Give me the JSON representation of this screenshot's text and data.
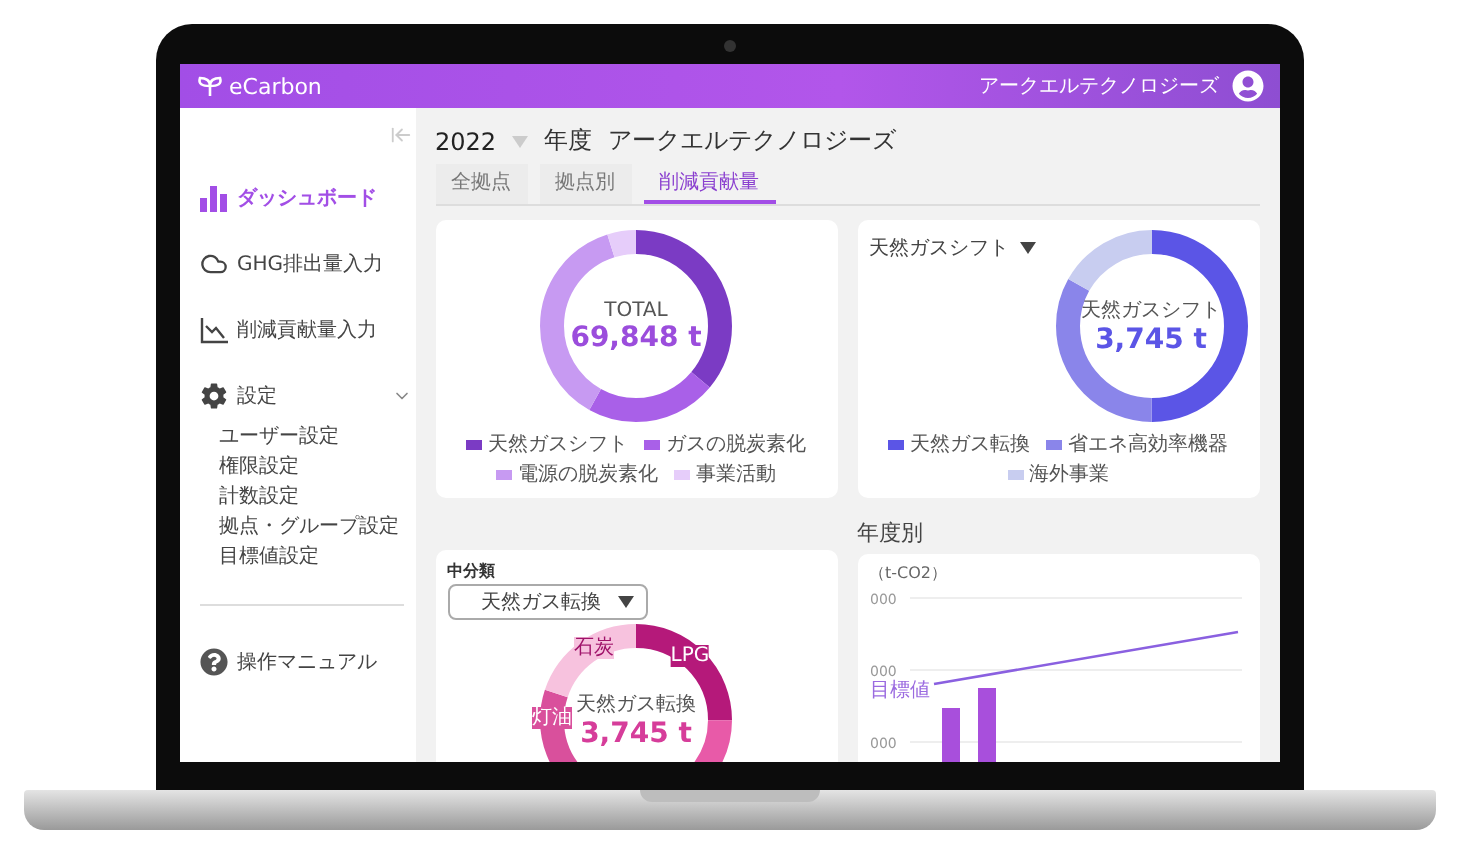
{
  "app": {
    "logo": "eCarbon",
    "company": "アークエルテクノロジーズ"
  },
  "sidebar": {
    "items": [
      {
        "label": "ダッシュボード",
        "selected": true
      },
      {
        "label": "GHG排出量入力",
        "selected": false
      },
      {
        "label": "削減貢献量入力",
        "selected": false
      },
      {
        "label": "設定",
        "selected": false,
        "expanded": true,
        "children": [
          {
            "label": "ユーザー設定"
          },
          {
            "label": "権限設定"
          },
          {
            "label": "計数設定"
          },
          {
            "label": "拠点・グループ設定"
          },
          {
            "label": "目標値設定"
          }
        ]
      }
    ],
    "help": {
      "label": "操作マニュアル"
    }
  },
  "header": {
    "year": "2022",
    "year_suffix": "年度",
    "company": "アークエルテクノロジーズ"
  },
  "tabs": [
    {
      "label": "全拠点",
      "selected": false
    },
    {
      "label": "拠点別",
      "selected": false
    },
    {
      "label": "削減貢献量",
      "selected": true
    }
  ],
  "total_card": {
    "center_label": "TOTAL",
    "center_value": "69,848 t",
    "legend": [
      {
        "label": "天然ガスシフト",
        "color": "#7b3bc4"
      },
      {
        "label": "ガスの脱炭素化",
        "color": "#a960e8"
      },
      {
        "label": "電源の脱炭素化",
        "color": "#c79af2"
      },
      {
        "label": "事業活動",
        "color": "#e6cdfa"
      }
    ]
  },
  "shift_card": {
    "dropdown": "天然ガスシフト",
    "center_label": "天然ガスシフト",
    "center_value": "3,745 t",
    "legend": [
      {
        "label": "天然ガス転換",
        "color": "#5b55e6"
      },
      {
        "label": "省エネ高効率機器",
        "color": "#8a85ea"
      },
      {
        "label": "海外事業",
        "color": "#c8cdf0"
      }
    ]
  },
  "conversion_card": {
    "filter_label": "中分類",
    "dropdown": "天然ガス転換",
    "segment_labels": [
      "LPG",
      "灯油",
      "石炭"
    ],
    "center_label": "天然ガス転換",
    "center_value": "3,745 t"
  },
  "yearly": {
    "title": "年度別",
    "unit": "（t-CO2）",
    "yticks": [
      "000",
      "000",
      "000"
    ],
    "target_label": "目標値"
  }
}
